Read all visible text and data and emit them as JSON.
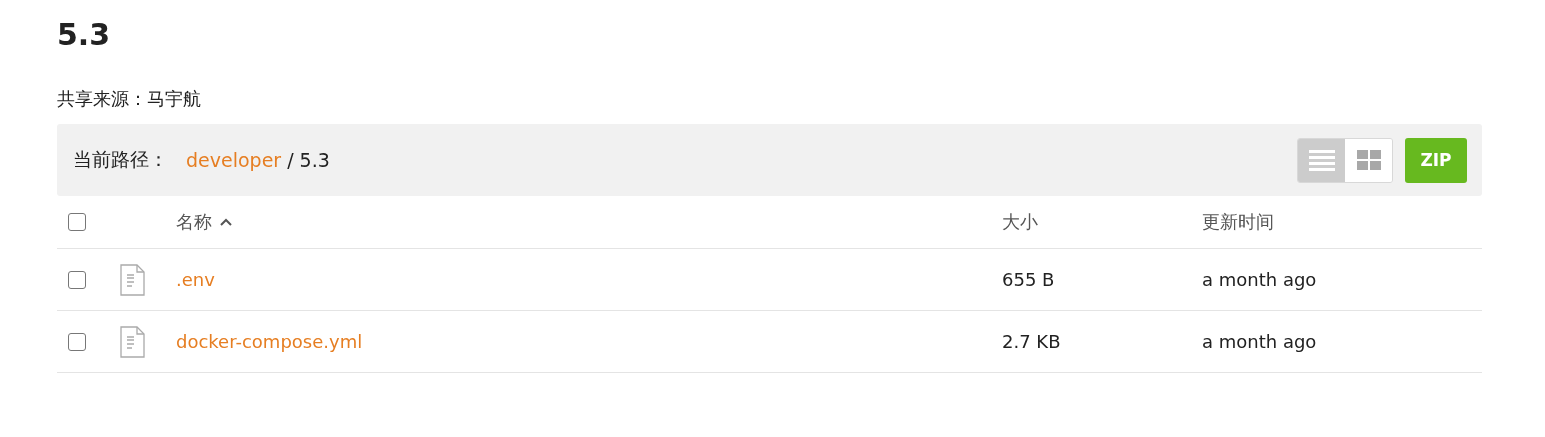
{
  "title": "5.3",
  "share_source": {
    "label": "共享来源：",
    "name": "马宇航"
  },
  "path_bar": {
    "label": "当前路径：",
    "crumbs": [
      {
        "text": "developer",
        "link": true
      },
      {
        "text": "5.3",
        "link": false
      }
    ],
    "separator": "/",
    "view_toggle": [
      {
        "kind": "list",
        "selected": true
      },
      {
        "kind": "grid",
        "selected": false
      }
    ],
    "zip_button": "ZIP"
  },
  "table": {
    "select_all": {
      "checked": false
    },
    "columns": [
      {
        "label": "名称",
        "sorted_ascending": true
      },
      {
        "label": "大小"
      },
      {
        "label": "更新时间"
      }
    ],
    "rows": [
      {
        "checked": false,
        "name": ".env",
        "size": "655 B",
        "updated": "a month ago"
      },
      {
        "checked": false,
        "name": "docker-compose.yml",
        "size": "2.7 KB",
        "updated": "a month ago"
      }
    ]
  }
}
